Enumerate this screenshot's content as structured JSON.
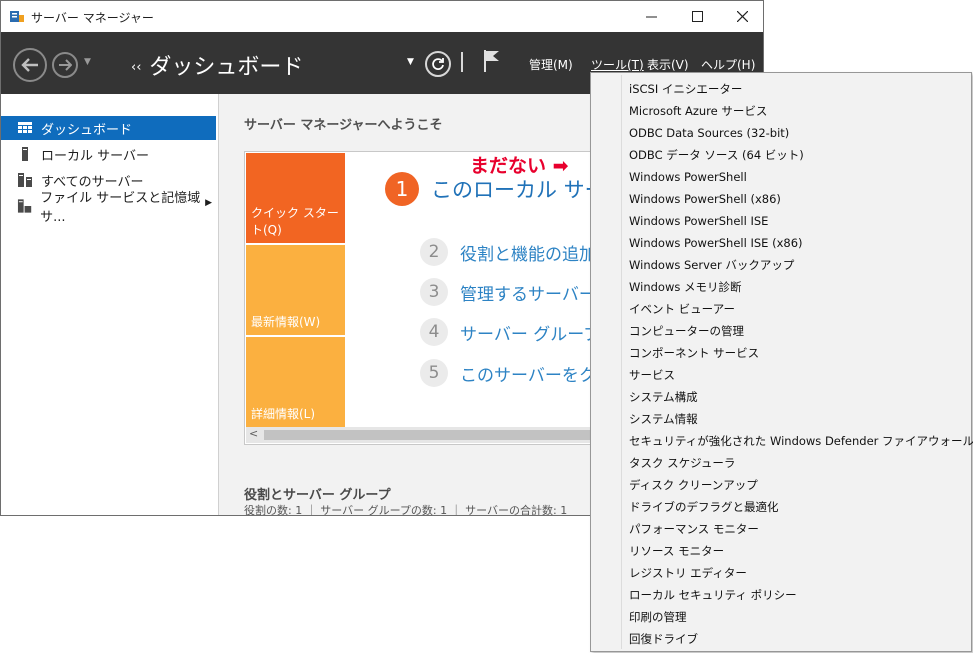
{
  "window": {
    "title": "サーバー マネージャー"
  },
  "header": {
    "breadcrumb_arrows": "‹‹",
    "breadcrumb": "ダッシュボード",
    "menu": [
      {
        "label": "管理(M)"
      },
      {
        "label": "ツール(T)"
      },
      {
        "label": "表示(V)"
      },
      {
        "label": "ヘルプ(H)"
      }
    ]
  },
  "sidebar": {
    "items": [
      {
        "label": "ダッシュボード",
        "icon": "dashboard-icon",
        "selected": true
      },
      {
        "label": "ローカル サーバー",
        "icon": "server-icon"
      },
      {
        "label": "すべてのサーバー",
        "icon": "servers-icon"
      },
      {
        "label": "ファイル サービスと記憶域サ...",
        "icon": "file-services-icon"
      }
    ]
  },
  "main": {
    "welcome": "サーバー マネージャーへようこそ",
    "tiles": [
      {
        "label": "クイック スタート(Q)",
        "color": "#f26522"
      },
      {
        "label": "最新情報(W)",
        "color": "#fbb040"
      },
      {
        "label": "詳細情報(L)",
        "color": "#fbb040"
      }
    ],
    "steps": [
      {
        "num": "1",
        "text": "このローカル サーバーの構成"
      },
      {
        "num": "2",
        "text": "役割と機能の追加"
      },
      {
        "num": "3",
        "text": "管理するサーバーの追加"
      },
      {
        "num": "4",
        "text": "サーバー グループの作成"
      },
      {
        "num": "5",
        "text": "このサーバーをクラウド サービスに接続する"
      }
    ],
    "scroll_left": "<",
    "roles_title": "役割とサーバー グループ",
    "roles_stats": "役割の数: 1 ｜ サーバー グループの数: 1 ｜ サーバーの合計数: 1"
  },
  "annotation": "まだない ➡",
  "tools_menu": [
    "iSCSI イニシエーター",
    "Microsoft Azure サービス",
    "ODBC Data Sources (32-bit)",
    "ODBC データ ソース (64 ビット)",
    "Windows PowerShell",
    "Windows PowerShell (x86)",
    "Windows PowerShell ISE",
    "Windows PowerShell ISE (x86)",
    "Windows Server バックアップ",
    "Windows メモリ診断",
    "イベント ビューアー",
    "コンピューターの管理",
    "コンポーネント サービス",
    "サービス",
    "システム構成",
    "システム情報",
    "セキュリティが強化された Windows Defender ファイアウォール",
    "タスク スケジューラ",
    "ディスク クリーンアップ",
    "ドライブのデフラグと最適化",
    "パフォーマンス モニター",
    "リソース モニター",
    "レジストリ エディター",
    "ローカル セキュリティ ポリシー",
    "印刷の管理",
    "回復ドライブ"
  ],
  "colors": {
    "header_bg": "#343434",
    "accent_blue": "#0f6cbd",
    "annotation_red": "#e8002d",
    "link_blue": "#2d83c4"
  }
}
